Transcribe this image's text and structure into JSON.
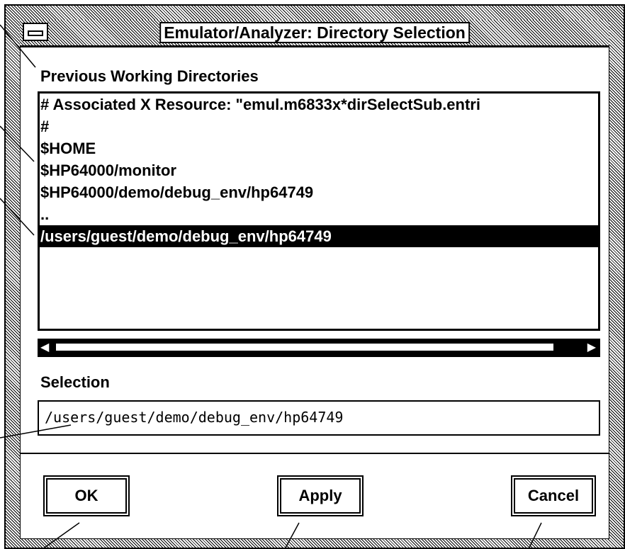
{
  "window": {
    "title": "Emulator/Analyzer: Directory Selection"
  },
  "previous": {
    "label": "Previous Working Directories",
    "items": [
      "# Associated X Resource: \"emul.m6833x*dirSelectSub.entri",
      "#",
      "$HOME",
      "$HP64000/monitor",
      "$HP64000/demo/debug_env/hp64749",
      "..",
      "/users/guest/demo/debug_env/hp64749"
    ],
    "selected_index": 6
  },
  "selection": {
    "label": "Selection",
    "value": "/users/guest/demo/debug_env/hp64749"
  },
  "buttons": {
    "ok": "OK",
    "apply": "Apply",
    "cancel": "Cancel"
  },
  "icons": {
    "window_menu": "window-menu-icon",
    "scroll_left": "scroll-left-arrow-icon",
    "scroll_right": "scroll-right-arrow-icon"
  }
}
